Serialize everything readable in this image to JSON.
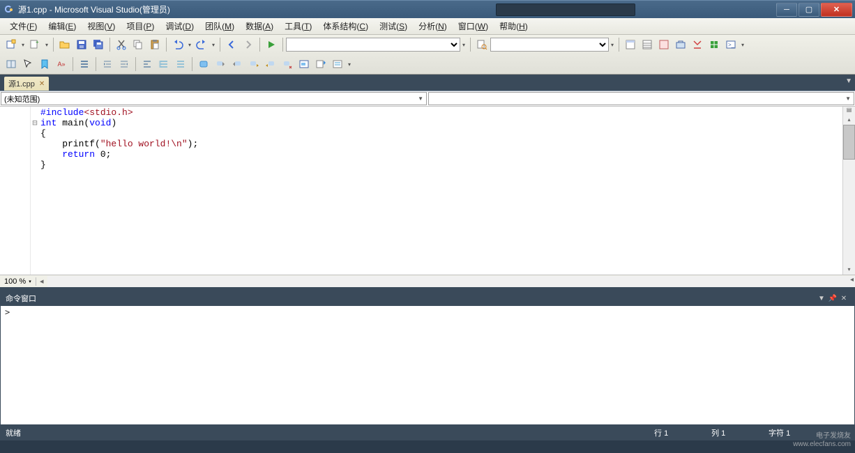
{
  "titlebar": {
    "title": "源1.cpp - Microsoft Visual Studio(管理员)"
  },
  "menu": {
    "items": [
      {
        "label": "文件",
        "accel": "F"
      },
      {
        "label": "编辑",
        "accel": "E"
      },
      {
        "label": "视图",
        "accel": "V"
      },
      {
        "label": "项目",
        "accel": "P"
      },
      {
        "label": "调试",
        "accel": "D"
      },
      {
        "label": "团队",
        "accel": "M"
      },
      {
        "label": "数据",
        "accel": "A"
      },
      {
        "label": "工具",
        "accel": "T"
      },
      {
        "label": "体系结构",
        "accel": "C"
      },
      {
        "label": "测试",
        "accel": "S"
      },
      {
        "label": "分析",
        "accel": "N"
      },
      {
        "label": "窗口",
        "accel": "W"
      },
      {
        "label": "帮助",
        "accel": "H"
      }
    ]
  },
  "tabs": {
    "active": "源1.cpp"
  },
  "nav": {
    "left": "(未知范围)",
    "right": ""
  },
  "code": {
    "lines": [
      {
        "outline": " ",
        "html": "<span class='pp'>#include</span><span class='inc'>&lt;stdio.h&gt;</span>"
      },
      {
        "outline": "⊟",
        "html": "<span class='kw'>int</span> main(<span class='kw'>void</span>)"
      },
      {
        "outline": " ",
        "html": "{"
      },
      {
        "outline": " ",
        "html": "    printf(<span class='str'>\"hello world!\\n\"</span>);"
      },
      {
        "outline": " ",
        "html": "    <span class='kw'>return</span> 0;"
      },
      {
        "outline": " ",
        "html": "}"
      }
    ]
  },
  "zoom": {
    "value": "100 %"
  },
  "command_window": {
    "title": "命令窗口",
    "prompt": ">"
  },
  "statusbar": {
    "status": "就绪",
    "line_label": "行",
    "line_val": "1",
    "col_label": "列",
    "col_val": "1",
    "char_label": "字符",
    "char_val": "1"
  },
  "watermark": {
    "line1": "电子发烧友",
    "line2": "www.elecfans.com"
  }
}
